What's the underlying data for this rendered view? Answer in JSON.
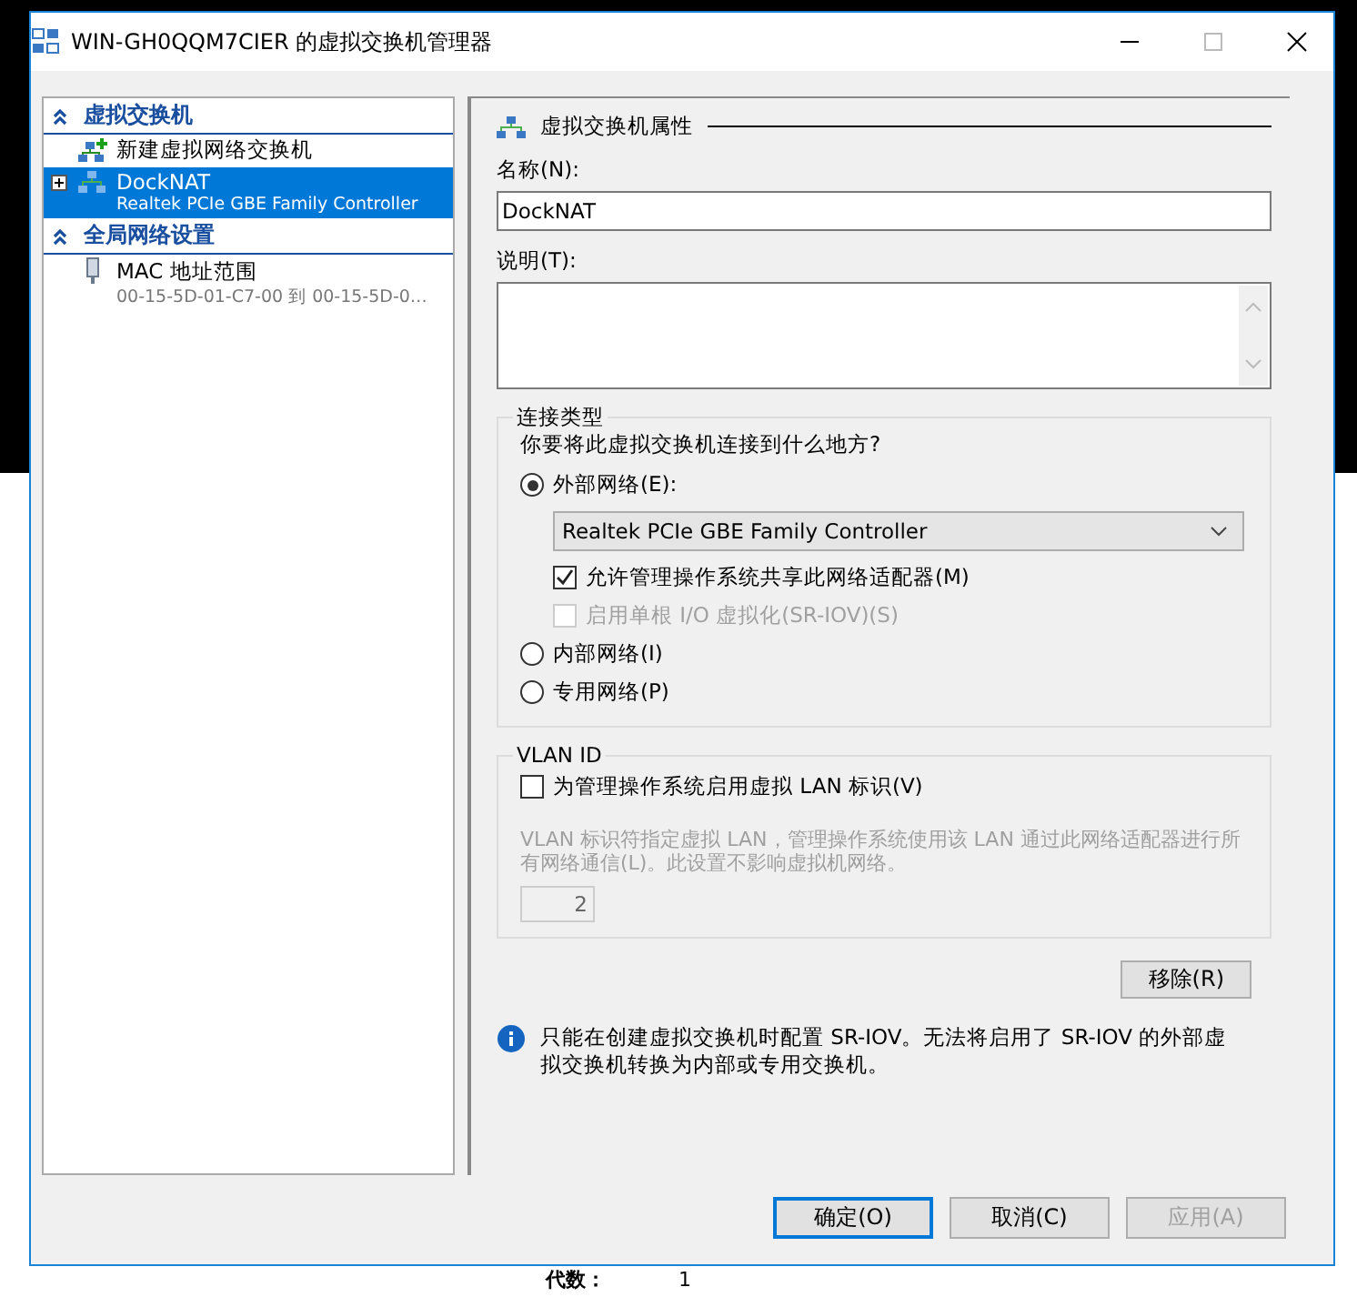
{
  "window": {
    "title": "WIN-GH0QQM7CIER 的虚拟交换机管理器"
  },
  "sidebar": {
    "sections": [
      {
        "title": "虚拟交换机",
        "expanded": true,
        "items": [
          {
            "kind": "new",
            "label": "新建虚拟网络交换机",
            "selected": false
          },
          {
            "kind": "switch",
            "label": "DockNAT",
            "sublabel": "Realtek PCIe GBE Family Controller",
            "selected": true,
            "expanded": false
          }
        ]
      },
      {
        "title": "全局网络设置",
        "expanded": true,
        "items": [
          {
            "kind": "mac",
            "label": "MAC 地址范围",
            "sublabel": "00-15-5D-01-C7-00 到 00-15-5D-0…",
            "selected": false
          }
        ]
      }
    ]
  },
  "properties": {
    "heading": "虚拟交换机属性",
    "name_label": "名称(N):",
    "name_value": "DockNAT",
    "description_label": "说明(T):",
    "connection": {
      "legend": "连接类型",
      "question": "你要将此虚拟交换机连接到什么地方?",
      "options": [
        {
          "label": "外部网络(E):",
          "selected": true,
          "adapter": "Realtek PCIe GBE Family Controller",
          "checkboxes": [
            {
              "label": "允许管理操作系统共享此网络适配器(M)",
              "checked": true,
              "disabled": false
            },
            {
              "label": "启用单根 I/O 虚拟化(SR-IOV)(S)",
              "checked": false,
              "disabled": true
            }
          ]
        },
        {
          "label": "内部网络(I)",
          "selected": false
        },
        {
          "label": "专用网络(P)",
          "selected": false
        }
      ]
    },
    "vlan": {
      "legend": "VLAN ID",
      "checkbox": {
        "label": "为管理操作系统启用虚拟 LAN 标识(V)",
        "checked": false
      },
      "note": "VLAN 标识符指定虚拟 LAN，管理操作系统使用该 LAN 通过此网络适配器进行所有网络通信(L)。此设置不影响虚拟机网络。",
      "id_value": "2"
    },
    "remove_button": "移除(R)",
    "info": "只能在创建虚拟交换机时配置 SR-IOV。无法将启用了 SR-IOV 的外部虚拟交换机转换为内部或专用交换机。"
  },
  "buttons": [
    {
      "label": "确定(O)",
      "disabled": false,
      "default": true
    },
    {
      "label": "取消(C)",
      "disabled": false,
      "default": false
    },
    {
      "label": "应用(A)",
      "disabled": true,
      "default": false
    }
  ],
  "background_window": {
    "label": "代数：",
    "value": "1"
  }
}
